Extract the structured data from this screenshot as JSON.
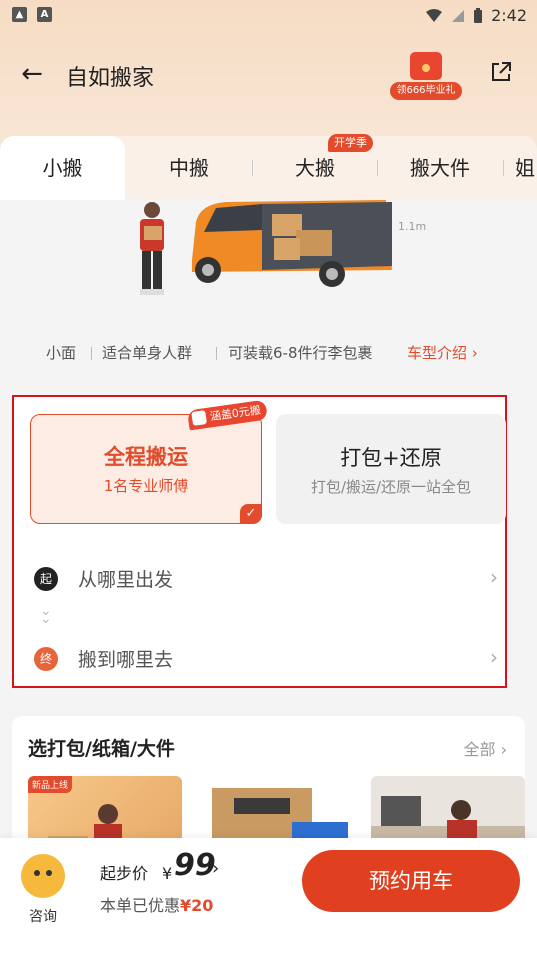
{
  "status_bar": {
    "time": "2:42"
  },
  "header": {
    "title": "自如搬家",
    "gift_label": "领666毕业礼"
  },
  "tabs": [
    {
      "label": "小搬",
      "active": true
    },
    {
      "label": "中搬",
      "active": false
    },
    {
      "label": "大搬",
      "active": false,
      "badge": "开学季"
    },
    {
      "label": "搬大件",
      "active": false
    },
    {
      "label": "姐",
      "active": false
    }
  ],
  "vehicle": {
    "dimension": "1.1m",
    "info": [
      "小面",
      "适合单身人群",
      "可装载6-8件行李包裹"
    ],
    "intro_link": "车型介绍 ›"
  },
  "services": {
    "promo_badge": "涵盖0元搬",
    "option1": {
      "title": "全程搬运",
      "subtitle": "1名专业师傅",
      "selected": true
    },
    "option2": {
      "title": "打包+还原",
      "subtitle": "打包/搬运/还原一站全包"
    }
  },
  "route": {
    "start_icon": "起",
    "start_text": "从哪里出发",
    "end_icon": "终",
    "end_text": "搬到哪里去"
  },
  "bundle": {
    "title": "选打包/纸箱/大件",
    "all_label": "全部",
    "thumb_tag": "新品上线"
  },
  "bottom": {
    "consult_label": "咨询",
    "price_label": "起步价",
    "currency": "¥",
    "price": "99",
    "discount_text": "本单已优惠",
    "discount_value": "¥20",
    "book_button": "预约用车"
  },
  "colors": {
    "accent": "#e24b2c",
    "highlight_border": "#d4131b"
  }
}
